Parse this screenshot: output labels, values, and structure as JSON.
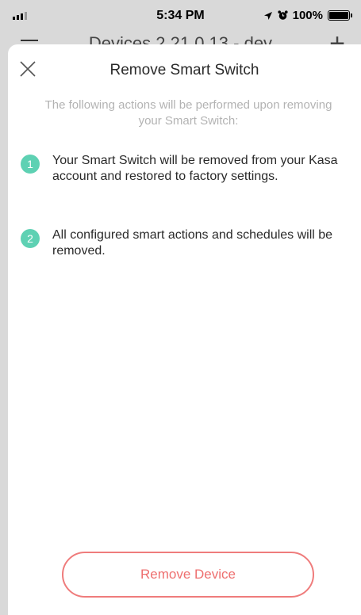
{
  "status_bar": {
    "time": "5:34 PM",
    "battery": "100%"
  },
  "background_screen": {
    "title": "Devices 2.21.0.13 - dev"
  },
  "sheet": {
    "title": "Remove Smart Switch",
    "subtitle": "The following actions will be performed upon removing your Smart Switch:",
    "steps": [
      {
        "number": "1",
        "text": "Your Smart Switch will be removed from your Kasa account and restored to factory settings."
      },
      {
        "number": "2",
        "text": "All configured smart actions and schedules will be removed."
      }
    ],
    "button_label": "Remove Device"
  },
  "colors": {
    "accent": "#5ed1b3",
    "danger": "#ee6f6f"
  }
}
